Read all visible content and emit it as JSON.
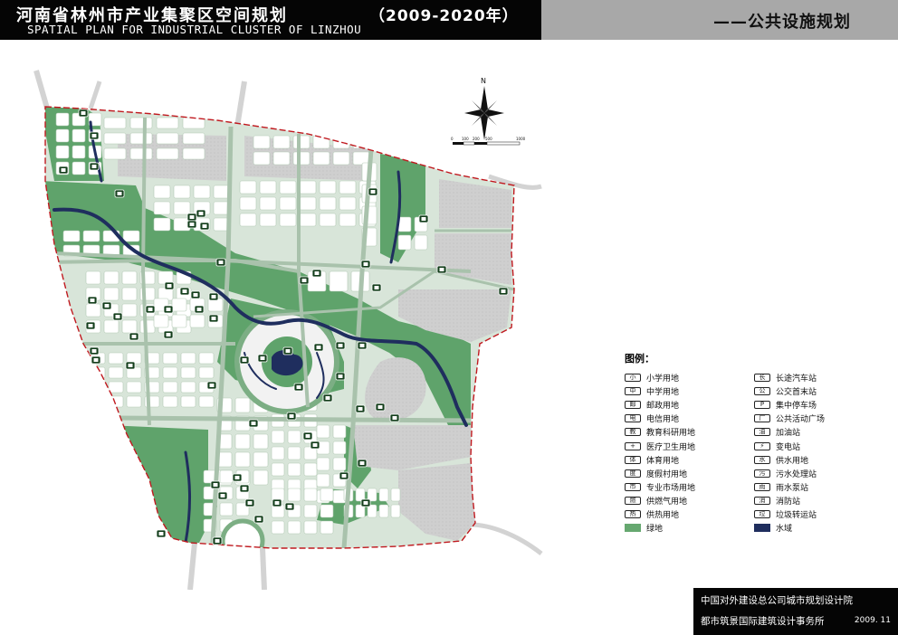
{
  "header": {
    "title": "河南省林州市产业集聚区空间规划",
    "years": "（2009-2020年）",
    "subtitle": "SPATIAL PLAN  FOR INDUSTRIAL CLUSTER OF LINZHOU",
    "theme": "——公共设施规划"
  },
  "compass": {
    "north": "N",
    "scale_labels": [
      "0",
      "100",
      "200",
      "500",
      "1000"
    ]
  },
  "legend": {
    "title": "图例：",
    "left": [
      {
        "label": "小学用地",
        "icon": "小"
      },
      {
        "label": "中学用地",
        "icon": "中"
      },
      {
        "label": "邮政用地",
        "icon": "邮"
      },
      {
        "label": "电信用地",
        "icon": "电"
      },
      {
        "label": "教育科研用地",
        "icon": "教"
      },
      {
        "label": "医疗卫生用地",
        "icon": "+"
      },
      {
        "label": "体育用地",
        "icon": "体"
      },
      {
        "label": "度假村用地",
        "icon": "度"
      },
      {
        "label": "专业市场用地",
        "icon": "市"
      },
      {
        "label": "供燃气用地",
        "icon": "燃"
      },
      {
        "label": "供热用地",
        "icon": "热"
      },
      {
        "label": "绿地",
        "swatch": "#66a870"
      }
    ],
    "right": [
      {
        "label": "长途汽车站",
        "icon": "长"
      },
      {
        "label": "公交首末站",
        "icon": "公"
      },
      {
        "label": "集中停车场",
        "icon": "P"
      },
      {
        "label": "公共活动广场",
        "icon": "广"
      },
      {
        "label": "加油站",
        "icon": "油"
      },
      {
        "label": "变电站",
        "icon": "⚡"
      },
      {
        "label": "供水用地",
        "icon": "水"
      },
      {
        "label": "污水处理站",
        "icon": "污"
      },
      {
        "label": "雨水泵站",
        "icon": "雨"
      },
      {
        "label": "消防站",
        "icon": "消"
      },
      {
        "label": "垃圾转运站",
        "icon": "垃"
      },
      {
        "label": "水域",
        "swatch": "#1f2e5e"
      }
    ]
  },
  "credits": {
    "line1": "中国对外建设总公司城市规划设计院",
    "line2": "都市筑景国际建筑设计事务所",
    "date": "2009. 11"
  },
  "colors": {
    "header_bg": "#050505",
    "theme_bg": "#a8a8a8",
    "green": "#5fa36b",
    "water": "#1f2e5e",
    "block": "#ffffff",
    "gray_block": "#d0d0d0",
    "road": "#b7ceb9",
    "boundary": "#c0191f"
  }
}
